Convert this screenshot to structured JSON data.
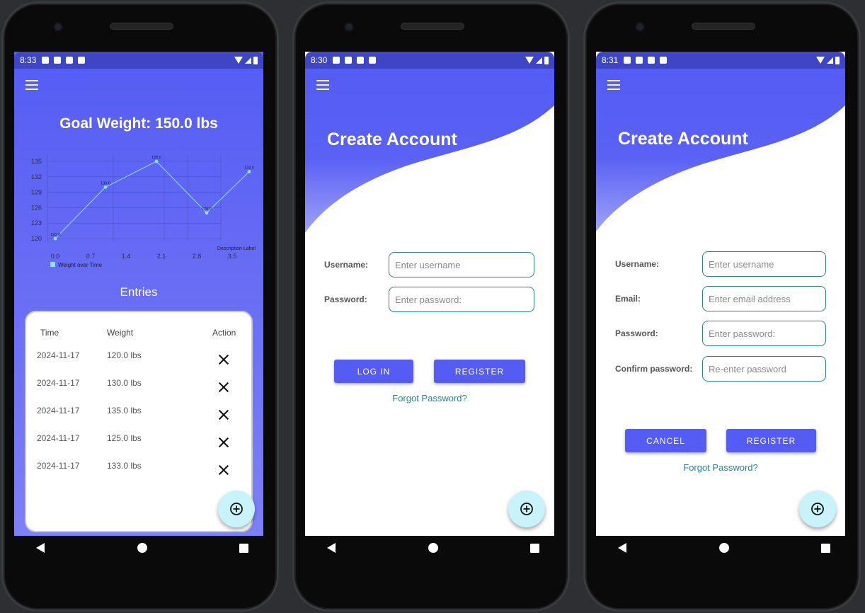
{
  "screen1": {
    "status_time": "8:33",
    "goal_title": "Goal Weight: 150.0 lbs",
    "entries_title": "Entries",
    "table": {
      "headers": [
        "Time",
        "Weight",
        "Action"
      ],
      "rows": [
        {
          "time": "2024-11-17",
          "weight": "120.0 lbs"
        },
        {
          "time": "2024-11-17",
          "weight": "130.0 lbs"
        },
        {
          "time": "2024-11-17",
          "weight": "135.0 lbs"
        },
        {
          "time": "2024-11-17",
          "weight": "125.0 lbs"
        },
        {
          "time": "2024-11-17",
          "weight": "133.0 lbs"
        }
      ]
    },
    "chart_data": {
      "type": "line",
      "x": [
        0.0,
        1.0,
        2.0,
        3.0,
        4.0
      ],
      "series": [
        {
          "name": "Weight over Time",
          "values": [
            120.0,
            130.0,
            135.0,
            125.0,
            133.0
          ]
        }
      ],
      "point_labels": [
        "120.0",
        "130.0",
        "135.0",
        "125.0",
        "133.0"
      ],
      "x_ticks": [
        "0.0",
        "0.7",
        "1.4",
        "2.1",
        "2.8",
        "3.5"
      ],
      "y_ticks": [
        "120",
        "123",
        "126",
        "129",
        "132",
        "135"
      ],
      "xlim": [
        0.0,
        4.0
      ],
      "ylim": [
        120,
        135
      ],
      "description": "Description Label",
      "legend": "bottom-left",
      "grid": true
    }
  },
  "screen2": {
    "status_time": "8:30",
    "title": "Create Account",
    "username_label": "Username:",
    "username_placeholder": "Enter username",
    "password_label": "Password:",
    "password_placeholder": "Enter password:",
    "login_label": "LOG IN",
    "register_label": "REGISTER",
    "forgot_label": "Forgot Password?"
  },
  "screen3": {
    "status_time": "8:31",
    "title": "Create Account",
    "username_label": "Username:",
    "username_placeholder": "Enter username",
    "email_label": "Email:",
    "email_placeholder": "Enter email address",
    "password_label": "Password:",
    "password_placeholder": "Enter password:",
    "confirm_label": "Confirm password:",
    "confirm_placeholder": "Re-enter password",
    "cancel_label": "CANCEL",
    "register_label": "REGISTER",
    "forgot_label": "Forgot Password?"
  },
  "colors": {
    "primary": "#545cf3",
    "status_bar": "#3f46c6",
    "fab": "#c8f3fa",
    "link": "#2f7f8f",
    "chart_line": "#8fe3f7"
  },
  "icons": {
    "menu": "menu-icon",
    "fab": "add-circle-icon",
    "delete": "close-icon"
  }
}
